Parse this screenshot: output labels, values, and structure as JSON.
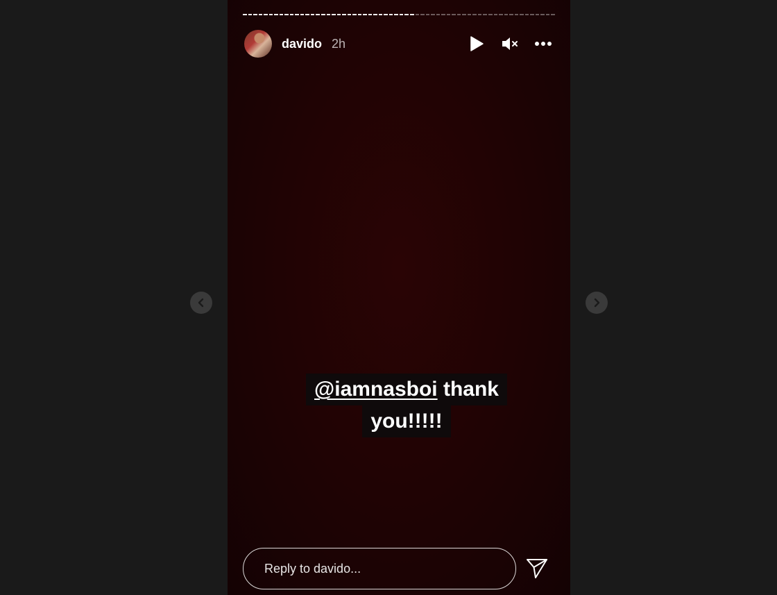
{
  "story": {
    "username": "davido",
    "time_ago": "2h",
    "progress": {
      "segment_count": 60,
      "completed_segments": 33
    },
    "caption": {
      "mention": "@iamnasboi",
      "line1_rest": " thank",
      "line2": "you!!!!!"
    },
    "reply": {
      "placeholder": "Reply to davido..."
    }
  },
  "icons": {
    "play": "play-icon",
    "mute": "muted-speaker-icon",
    "more": "more-options-icon",
    "send": "send-icon",
    "prev": "chevron-left-icon",
    "next": "chevron-right-icon"
  },
  "colors": {
    "page_background": "#1a1a1a",
    "story_background": "#210304",
    "caption_background": "#0f0a0b",
    "text": "#ffffff"
  }
}
